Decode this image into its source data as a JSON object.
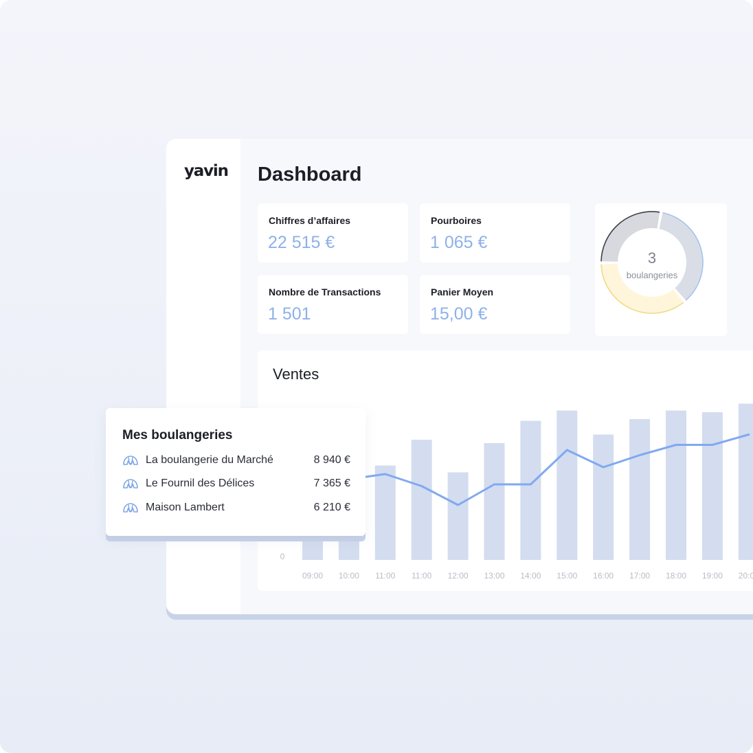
{
  "app": {
    "logo": "yavin",
    "page_title": "Dashboard"
  },
  "kpis": [
    {
      "label": "Chiffres d’affaires",
      "value": "22 515 €"
    },
    {
      "label": "Pourboires",
      "value": "1 065 €"
    },
    {
      "label": "Nombre de Transactions",
      "value": "1 501"
    },
    {
      "label": "Panier Moyen",
      "value": "15,00 €"
    }
  ],
  "donut": {
    "count": "3",
    "label": "boulangeries",
    "segments": [
      {
        "share": 0.36,
        "color": "#d9dde6",
        "accent": "#a5c3ee"
      },
      {
        "share": 0.36,
        "color": "#fff5da",
        "accent": "#ecdc8a"
      },
      {
        "share": 0.28,
        "color": "#d8d9de",
        "accent": "#3d3f49"
      }
    ]
  },
  "sales": {
    "title": "Ventes",
    "y_zero_label": "0"
  },
  "chart_data": {
    "type": "bar",
    "title": "Ventes",
    "categories": [
      "09:00",
      "10:00",
      "11:00",
      "11:00",
      "12:00",
      "13:00",
      "14:00",
      "15:00",
      "16:00",
      "17:00",
      "18:00",
      "19:00",
      "20:00"
    ],
    "series": [
      {
        "values": [
          13,
          15,
          55,
          70,
          51,
          68,
          81,
          87,
          73,
          82,
          87,
          86,
          91
        ],
        "color": "#d3ddef"
      },
      {
        "values": [
          45,
          47,
          50,
          43,
          32,
          44,
          44,
          64,
          54,
          61,
          67,
          67,
          73
        ],
        "color": "#80a9f0"
      }
    ],
    "ylim": [
      0,
      100
    ],
    "xlabel": "",
    "ylabel": ""
  },
  "bakeries": {
    "title": "Mes boulangeries",
    "items": [
      {
        "name": "La boulangerie du Marché",
        "amount": "8 940 €",
        "icon": "croissant-icon"
      },
      {
        "name": "Le Fournil des Délices",
        "amount": "7 365 €",
        "icon": "croissant-icon"
      },
      {
        "name": "Maison Lambert",
        "amount": "6 210 €",
        "icon": "croissant-icon"
      }
    ]
  }
}
